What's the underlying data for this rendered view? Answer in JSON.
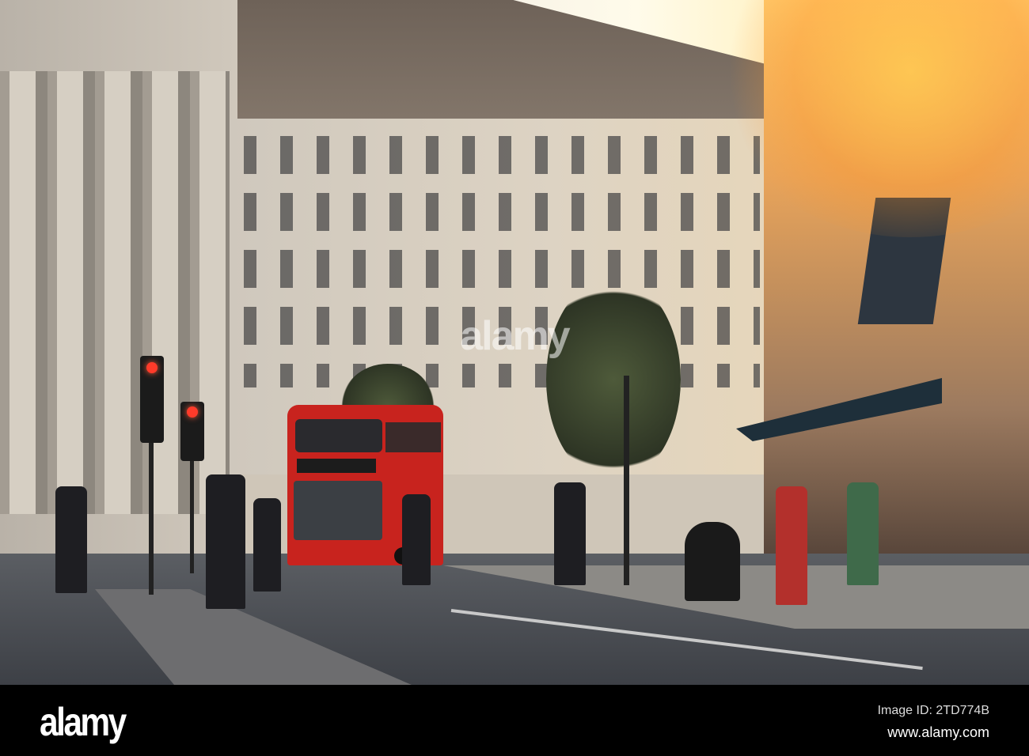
{
  "photo": {
    "subject": "London street with red double-decker bus",
    "watermark": "alamy"
  },
  "footer": {
    "logo": "alamy",
    "image_id": "Image ID: 2TD774B",
    "website": "www.alamy.com"
  },
  "colors": {
    "bus_red": "#c8231e",
    "bar_bg": "#000000"
  }
}
